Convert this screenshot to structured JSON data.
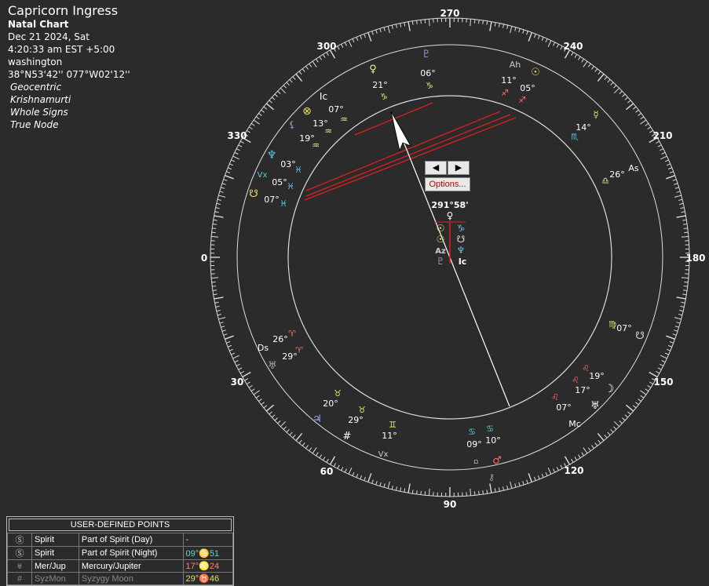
{
  "chart_info": {
    "title": "Capricorn Ingress",
    "chart_type": "Natal Chart",
    "date": "Dec 21 2024, Sat",
    "time": "4:20:33 am  EST +5:00",
    "location": "washington",
    "coords": "38°N53'42'' 077°W02'12''",
    "options": [
      "Geocentric",
      "Krishnamurti",
      "Whole Signs",
      "True Node"
    ]
  },
  "degree_labels": [
    "270",
    "240",
    "210",
    "180",
    "150",
    "120",
    "90",
    "60",
    "30",
    "0",
    "330",
    "300"
  ],
  "pointer_readout": "291°58'",
  "nav": {
    "prev": "◀",
    "next": "▶",
    "options_label": "Options..."
  },
  "glyph_labels": {
    "venus_deg": "21°",
    "pluto_deg": "06°",
    "saturn_house_deg": "07°",
    "ve_sign": "♑",
    "pl_sign": "♑",
    "ic": "Ic",
    "fortuna": "⊗",
    "lilith_deg": "13°",
    "lilith_glyph": "⚸",
    "uranus_sign_deg": "19°",
    "neptune_deg": "03°",
    "saturn_deg": "05°",
    "node_deg": "07°",
    "neptune": "♆",
    "vertex": "Vx",
    "node": "☋",
    "asc_deg": "26°",
    "asc": "As",
    "mercury_deg": "14°",
    "mercury": "☿",
    "sun_deg": "05°",
    "ah_deg": "11°",
    "ah": "Ah",
    "sun": "☉",
    "moon": "☽",
    "dsc": "Ds",
    "dsc_deg1": "26°",
    "dsc_deg2": "29°",
    "uranus": "♅",
    "jupiter_deg1": "20°",
    "jupiter_deg2": "29°",
    "gemini_deg": "11°",
    "jupiter": "♃",
    "mc": "Mc",
    "mc_deg": "07°",
    "moon_deg1": "19°",
    "moon_deg2": "17°",
    "virgo_deg": "07°",
    "cancer_deg1": "09°",
    "cancer_deg2": "10°",
    "mars": "♂",
    "ares": "♈",
    "aquarius": "♒",
    "pisces": "♓",
    "taurus": "♉",
    "gemini": "♊",
    "cancer": "♋",
    "leo": "♌",
    "virgo": "♍",
    "libra": "♎",
    "scorpio": "♏",
    "sagittarius": "♐",
    "capricorn": "♑",
    "sharp": "#",
    "pointer_venus": "♀",
    "pointer_sun": "☉",
    "pointer_cap": "♑",
    "pointer_node": "☋",
    "pointer_nep": "♆",
    "pointer_az": "Az",
    "pointer_ic": "Ic",
    "pointer_pluto": "♇"
  },
  "user_defined_points": {
    "title": "USER-DEFINED POINTS",
    "rows": [
      {
        "icon": "Ⓢ",
        "name": "Spirit",
        "desc": "Part of Spirit (Day)",
        "value": "-",
        "color": "#cccccc"
      },
      {
        "icon": "Ⓢ",
        "name": "Spirit",
        "desc": "Part of Spirit (Night)",
        "value": "09°♋51",
        "color": "#5ed6d6"
      },
      {
        "icon": "♅",
        "name": "Mer/Jup",
        "desc": "Mercury/Jupiter",
        "value": "17°♌24",
        "color": "#ff7f7f"
      },
      {
        "icon": "#",
        "name": "SyzMon",
        "desc": "Syzygy Moon",
        "value": "29°♉46",
        "color": "#e0e060"
      }
    ]
  },
  "colors": {
    "fire": "#ff6b6b",
    "earth": "#e6e66a",
    "air": "#f0f0a0",
    "water": "#5ec8e6",
    "line": "#dd1f1f",
    "disabled": "#8a8a8a"
  }
}
